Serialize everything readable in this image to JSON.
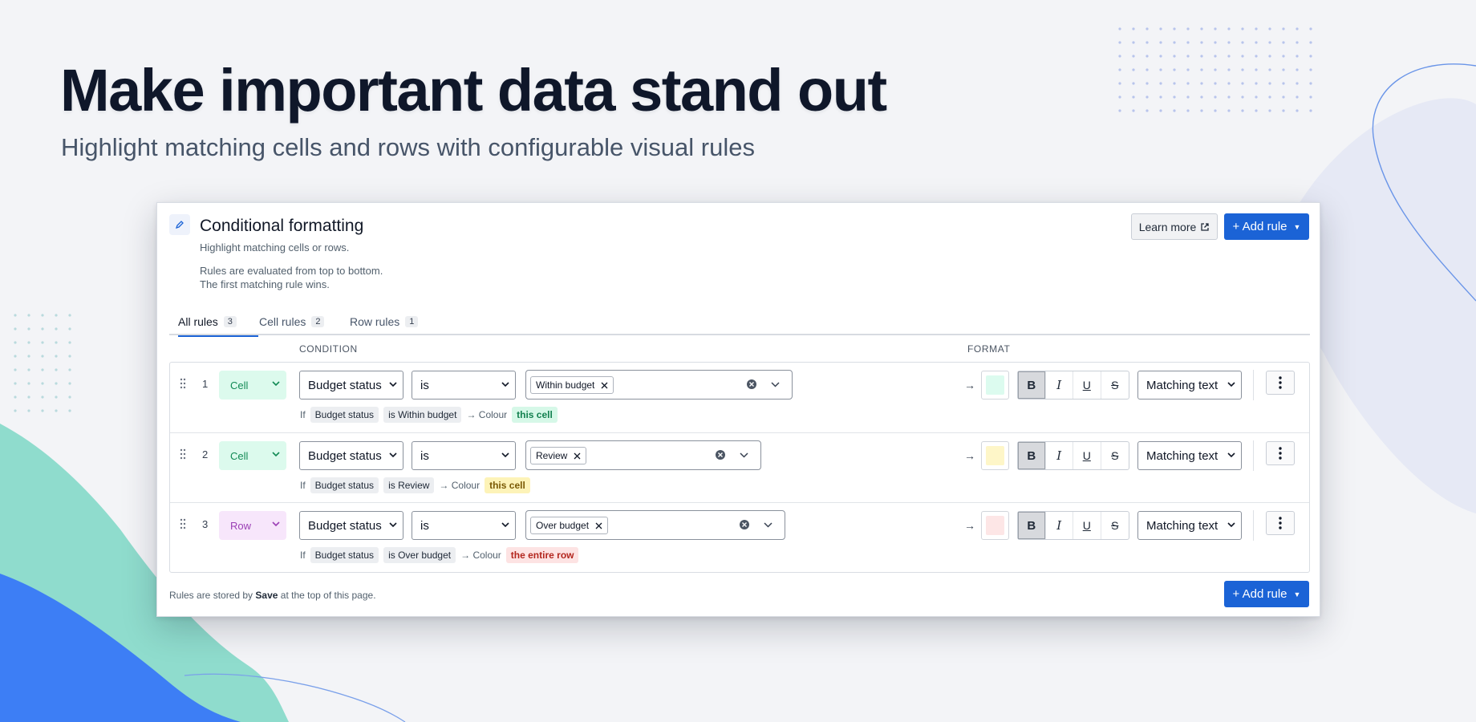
{
  "hero": {
    "title": "Make important data stand out",
    "subtitle": "Highlight matching cells and rows with configurable visual rules"
  },
  "panel": {
    "title": "Conditional formatting",
    "description": "Highlight matching cells or rows.",
    "note_line1": "Rules are evaluated from top to bottom.",
    "note_line2": "The first matching rule wins.",
    "learn_more": "Learn more",
    "add_rule": "+ Add rule",
    "tabs": [
      {
        "label": "All rules",
        "count": "3"
      },
      {
        "label": "Cell rules",
        "count": "2"
      },
      {
        "label": "Row rules",
        "count": "1"
      }
    ],
    "columns": {
      "condition": "CONDITION",
      "format": "FORMAT"
    },
    "rules": [
      {
        "number": "1",
        "type": "Cell",
        "type_bg": "#dcfaed",
        "type_fg": "#128a55",
        "field": "Budget status",
        "operator": "is",
        "value": "Within budget",
        "summary_if": "If",
        "summary_field": "Budget status",
        "summary_cond": "is Within budget",
        "summary_colour": "→ Colour",
        "summary_target": "this cell",
        "target_bg": "#d6f8e8",
        "target_fg": "#12804f",
        "swatch": "#dcfbef",
        "arrow": "→",
        "bold": "B",
        "italic": "I",
        "underline": "U",
        "strike": "S",
        "apply_to": "Matching text"
      },
      {
        "number": "2",
        "type": "Cell",
        "type_bg": "#dcfaed",
        "type_fg": "#128a55",
        "field": "Budget status",
        "operator": "is",
        "value": "Review",
        "summary_if": "If",
        "summary_field": "Budget status",
        "summary_cond": "is Review",
        "summary_colour": "→ Colour",
        "summary_target": "this cell",
        "target_bg": "#fdf3b8",
        "target_fg": "#7a5a05",
        "swatch": "#fef6c8",
        "arrow": "→",
        "bold": "B",
        "italic": "I",
        "underline": "U",
        "strike": "S",
        "apply_to": "Matching text"
      },
      {
        "number": "3",
        "type": "Row",
        "type_bg": "#f7e6fb",
        "type_fg": "#9b3fb5",
        "field": "Budget status",
        "operator": "is",
        "value": "Over budget",
        "summary_if": "If",
        "summary_field": "Budget status",
        "summary_cond": "is Over budget",
        "summary_colour": "→ Colour",
        "summary_target": "the entire row",
        "target_bg": "#fde3e3",
        "target_fg": "#b3261e",
        "swatch": "#fde6e6",
        "arrow": "→",
        "bold": "B",
        "italic": "I",
        "underline": "U",
        "strike": "S",
        "apply_to": "Matching text"
      }
    ],
    "footer_pre": "Rules are stored by",
    "footer_bold": "Save",
    "footer_post": "at the top of this page."
  },
  "colors": {
    "accent": "#1b63d6",
    "teal_shape": "#8fdccd",
    "blue_shape": "#3d7ef5"
  }
}
